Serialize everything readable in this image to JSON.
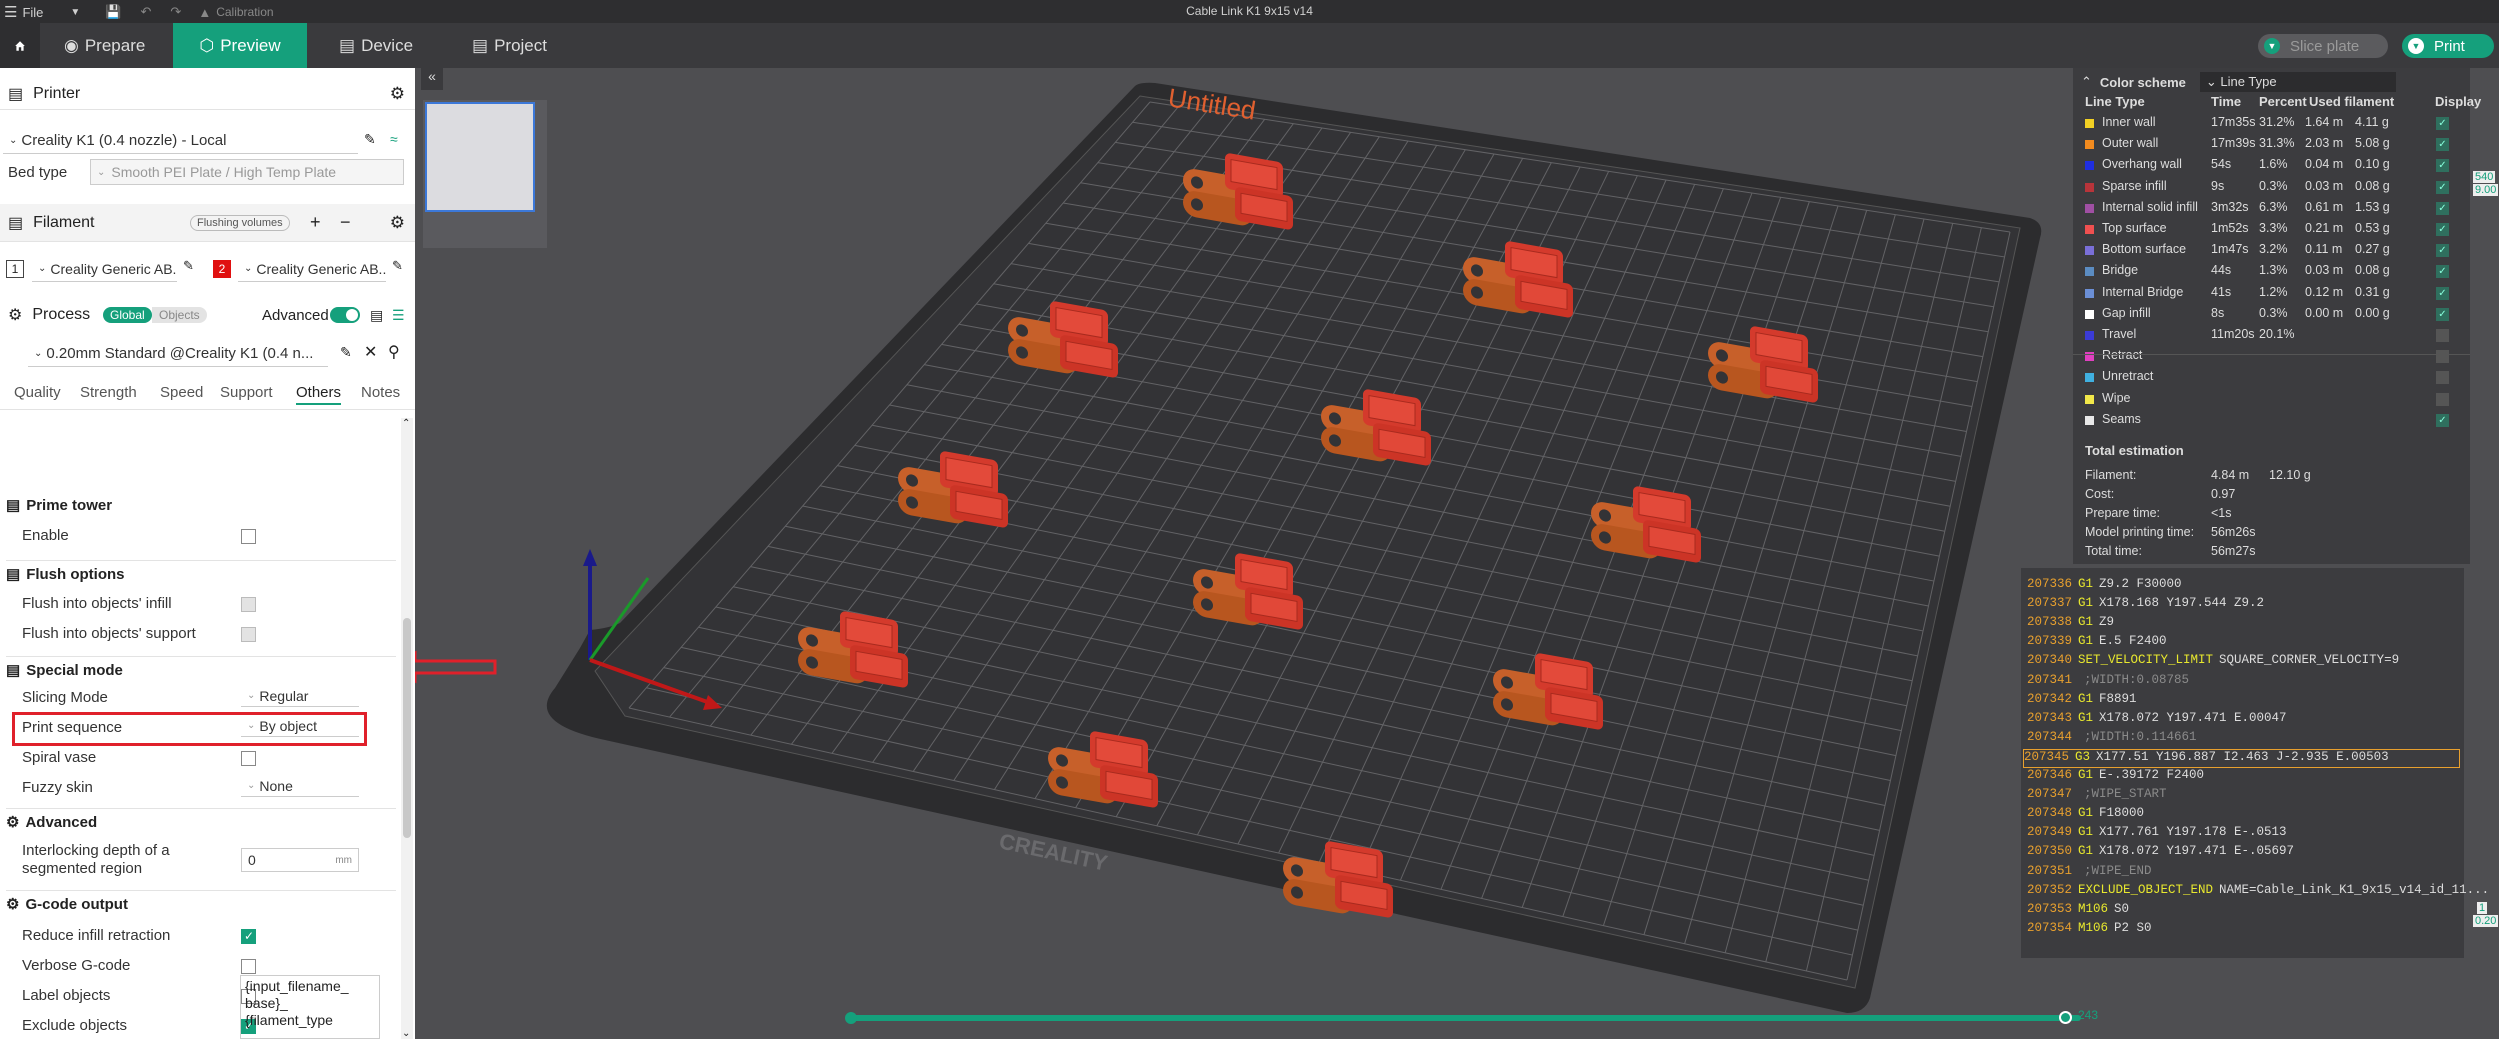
{
  "window": {
    "title": "Cable Link K1 9x15 v14",
    "file_menu": "File",
    "calibration": "Calibration"
  },
  "tabs": {
    "prepare": "Prepare",
    "preview": "Preview",
    "device": "Device",
    "project": "Project"
  },
  "actions": {
    "slice_plate": "Slice plate",
    "print": "Print"
  },
  "printer": {
    "section": "Printer",
    "name": "Creality K1 (0.4 nozzle) - Local",
    "bed_type_label": "Bed type",
    "bed_type": "Smooth PEI Plate / High Temp Plate"
  },
  "filament": {
    "section": "Filament",
    "flushing": "Flushing volumes",
    "slot1_num": "1",
    "slot1": "Creality Generic AB...",
    "slot2_num": "2",
    "slot2": "Creality Generic AB..."
  },
  "process": {
    "section": "Process",
    "global": "Global",
    "objects": "Objects",
    "advanced": "Advanced",
    "preset": "0.20mm Standard @Creality K1 (0.4 n..."
  },
  "subtabs": [
    "Quality",
    "Strength",
    "Speed",
    "Support",
    "Others",
    "Notes"
  ],
  "settings": {
    "prime_tower": "Prime tower",
    "enable": "Enable",
    "flush_options": "Flush options",
    "flush_infill": "Flush into objects' infill",
    "flush_support": "Flush into objects' support",
    "special_mode": "Special mode",
    "slicing_mode": "Slicing Mode",
    "slicing_mode_val": "Regular",
    "print_sequence": "Print sequence",
    "print_sequence_val": "By object",
    "spiral_vase": "Spiral vase",
    "fuzzy_skin": "Fuzzy skin",
    "fuzzy_skin_val": "None",
    "advanced": "Advanced",
    "interlocking_1": "Interlocking depth of a",
    "interlocking_2": "segmented region",
    "interlocking_val": "0",
    "interlocking_unit": "mm",
    "gcode_output": "G-code output",
    "reduce_retraction": "Reduce infill retraction",
    "verbose": "Verbose G-code",
    "label_objects": "Label objects",
    "exclude_objects": "Exclude objects",
    "filename_1": "{input_filename_",
    "filename_2": "base}_",
    "filename_3": "{filament_type"
  },
  "viewport": {
    "plate_label": "Untitled",
    "brand": "CREALITY",
    "slider_value": "243",
    "right_val_1": "540",
    "right_val_2": "9.00",
    "right_val_3": "1",
    "right_val_4": "0.20"
  },
  "legend": {
    "title": "Color scheme",
    "scheme": "Line Type",
    "headers": [
      "Line Type",
      "Time",
      "Percent",
      "Used filament",
      "Display"
    ],
    "rows": [
      {
        "name": "Inner wall",
        "color": "#f2d024",
        "time": "17m35s",
        "pct": "31.2%",
        "len": "1.64 m",
        "wt": "4.11 g",
        "on": true
      },
      {
        "name": "Outer wall",
        "color": "#f28b1f",
        "time": "17m39s",
        "pct": "31.3%",
        "len": "2.03 m",
        "wt": "5.08 g",
        "on": true
      },
      {
        "name": "Overhang wall",
        "color": "#1f2ee0",
        "time": "54s",
        "pct": "1.6%",
        "len": "0.04 m",
        "wt": "0.10 g",
        "on": true
      },
      {
        "name": "Sparse infill",
        "color": "#b8343a",
        "time": "9s",
        "pct": "0.3%",
        "len": "0.03 m",
        "wt": "0.08 g",
        "on": true
      },
      {
        "name": "Internal solid infill",
        "color": "#a04fa3",
        "time": "3m32s",
        "pct": "6.3%",
        "len": "0.61 m",
        "wt": "1.53 g",
        "on": true
      },
      {
        "name": "Top surface",
        "color": "#f05050",
        "time": "1m52s",
        "pct": "3.3%",
        "len": "0.21 m",
        "wt": "0.53 g",
        "on": true
      },
      {
        "name": "Bottom surface",
        "color": "#7a6fd8",
        "time": "1m47s",
        "pct": "3.2%",
        "len": "0.11 m",
        "wt": "0.27 g",
        "on": true
      },
      {
        "name": "Bridge",
        "color": "#5b8cc2",
        "time": "44s",
        "pct": "1.3%",
        "len": "0.03 m",
        "wt": "0.08 g",
        "on": true
      },
      {
        "name": "Internal Bridge",
        "color": "#6b8fd6",
        "time": "41s",
        "pct": "1.2%",
        "len": "0.12 m",
        "wt": "0.31 g",
        "on": true
      },
      {
        "name": "Gap infill",
        "color": "#ffffff",
        "time": "8s",
        "pct": "0.3%",
        "len": "0.00 m",
        "wt": "0.00 g",
        "on": true
      },
      {
        "name": "Travel",
        "color": "#3b3bd6",
        "time": "11m20s",
        "pct": "20.1%",
        "len": "",
        "wt": "",
        "on": false
      },
      {
        "name": "Retract",
        "color": "#e040c0",
        "time": "",
        "pct": "",
        "len": "",
        "wt": "",
        "on": false
      },
      {
        "name": "Unretract",
        "color": "#40b0e0",
        "time": "",
        "pct": "",
        "len": "",
        "wt": "",
        "on": false
      },
      {
        "name": "Wipe",
        "color": "#f2e84a",
        "time": "",
        "pct": "",
        "len": "",
        "wt": "",
        "on": false
      },
      {
        "name": "Seams",
        "color": "#e8e8e8",
        "time": "",
        "pct": "",
        "len": "",
        "wt": "",
        "on": true
      }
    ],
    "total_title": "Total estimation",
    "totals": [
      {
        "k": "Filament:",
        "v": "4.84 m",
        "v2": "12.10 g"
      },
      {
        "k": "Cost:",
        "v": "0.97",
        "v2": ""
      },
      {
        "k": "Prepare time:",
        "v": "<1s",
        "v2": ""
      },
      {
        "k": "Model printing time:",
        "v": "56m26s",
        "v2": ""
      },
      {
        "k": "Total time:",
        "v": "56m27s",
        "v2": ""
      }
    ]
  },
  "gcode": [
    {
      "n": "207336",
      "c": "G1",
      "a": "Z9.2 F30000",
      "t": "cmd"
    },
    {
      "n": "207337",
      "c": "G1",
      "a": "X178.168 Y197.544 Z9.2",
      "t": "cmd"
    },
    {
      "n": "207338",
      "c": "G1",
      "a": "Z9",
      "t": "cmd"
    },
    {
      "n": "207339",
      "c": "G1",
      "a": "E.5 F2400",
      "t": "cmd"
    },
    {
      "n": "207340",
      "c": "SET_VELOCITY_LIMIT",
      "a": "SQUARE_CORNER_VELOCITY=9",
      "t": "cmd"
    },
    {
      "n": "207341",
      "c": "",
      "a": ";WIDTH:0.08785",
      "t": "cmt"
    },
    {
      "n": "207342",
      "c": "G1",
      "a": "F8891",
      "t": "cmd"
    },
    {
      "n": "207343",
      "c": "G1",
      "a": "X178.072 Y197.471 E.00047",
      "t": "cmd"
    },
    {
      "n": "207344",
      "c": "",
      "a": ";WIDTH:0.114661",
      "t": "cmt"
    },
    {
      "n": "207345",
      "c": "G3",
      "a": "X177.51 Y196.887 I2.463 J-2.935 E.00503",
      "t": "sel"
    },
    {
      "n": "207346",
      "c": "G1",
      "a": "E-.39172 F2400",
      "t": "cmd"
    },
    {
      "n": "207347",
      "c": "",
      "a": ";WIPE_START",
      "t": "cmt"
    },
    {
      "n": "207348",
      "c": "G1",
      "a": "F18000",
      "t": "cmd"
    },
    {
      "n": "207349",
      "c": "G1",
      "a": "X177.761 Y197.178 E-.0513",
      "t": "cmd"
    },
    {
      "n": "207350",
      "c": "G1",
      "a": "X178.072 Y197.471 E-.05697",
      "t": "cmd"
    },
    {
      "n": "207351",
      "c": "",
      "a": ";WIPE_END",
      "t": "cmt"
    },
    {
      "n": "207352",
      "c": "EXCLUDE_OBJECT_END",
      "a": "NAME=Cable_Link_K1_9x15_v14_id_11...",
      "t": "cmd"
    },
    {
      "n": "207353",
      "c": "M106",
      "a": "S0",
      "t": "cmd"
    },
    {
      "n": "207354",
      "c": "M106",
      "a": "P2 S0",
      "t": "cmd"
    }
  ]
}
